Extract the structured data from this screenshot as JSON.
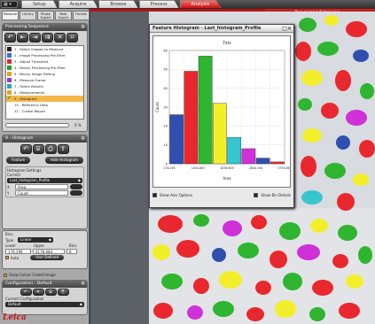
{
  "topbar": {
    "tabs": [
      "Setup",
      "Acquire",
      "Browse",
      "Process",
      "Analysis"
    ],
    "active_tab": "Analysis",
    "processed_label": "Processed Image"
  },
  "left": {
    "subtabs": [
      "Measure",
      "Library",
      "Phase Expert",
      "Blob Expert",
      "Format"
    ],
    "sequence": {
      "title": "Processing Sequence",
      "items": [
        "1 - Select Images to Measure",
        "2 - Image Processing Pre-Filter",
        "3 - Adjust Threshold",
        "4 - Binary Processing Pre-Filter",
        "5 - Binary Image Editing",
        "6 - Measure Frame",
        "7 - Select Results",
        "8 - Measurements",
        "9 - Histogram",
        "10 - Reference Data",
        "11 - Create Report"
      ],
      "active_index": 8,
      "progress_percent": 0,
      "progress_label": "0 %"
    },
    "histogram_panel": {
      "title": "9 - Histogram",
      "btn_feature": "Feature",
      "btn_hide": "Hide Histogram",
      "settings_title": "Histogram Settings",
      "current_label": "Current",
      "current_value": "Last_histogram_Profile",
      "x_label": "X",
      "x_value": "Area",
      "y_label": "Y",
      "y_value": "Count",
      "bins_title": "Bins",
      "type_label": "Type",
      "type_value": "Linear",
      "lower_label": "Lower",
      "upper_label": "Upper",
      "bins_label": "Bins",
      "lower_value": "176.196",
      "upper_value": "4178.684",
      "bins_value": "8",
      "auto_label": "Auto",
      "user_defined_label": "User Defined",
      "show_colour_label": "Show Colour Coded Image"
    },
    "config": {
      "title": "Configuration - Default",
      "current_label": "Current Configuration",
      "current_value": "Default"
    },
    "logo": "Leica"
  },
  "histogram_window": {
    "title": "Feature Histogram - Last_histogram_Profile",
    "foot_left": "Show Axis Options",
    "foot_right": "Show Bin Details"
  },
  "chart_data": {
    "type": "bar",
    "title": "Title",
    "xlabel": "Area",
    "ylabel": "Count",
    "categories": [
      "176.195",
      "",
      "1004.803",
      "",
      "1836.605",
      "",
      "2844.194",
      "",
      "3755.661"
    ],
    "values": [
      26,
      49,
      57,
      32,
      14,
      8,
      3,
      1
    ],
    "bar_colors": [
      "#2f4fb0",
      "#e8282e",
      "#2fb52f",
      "#f2ef2a",
      "#36c6cf",
      "#d030d8",
      "#2f4fb0",
      "#e8282e"
    ],
    "ylim": [
      0,
      60
    ],
    "ytick_labels": [
      "0",
      "10",
      "20",
      "30",
      "40",
      "50",
      "60"
    ],
    "grid": true
  }
}
